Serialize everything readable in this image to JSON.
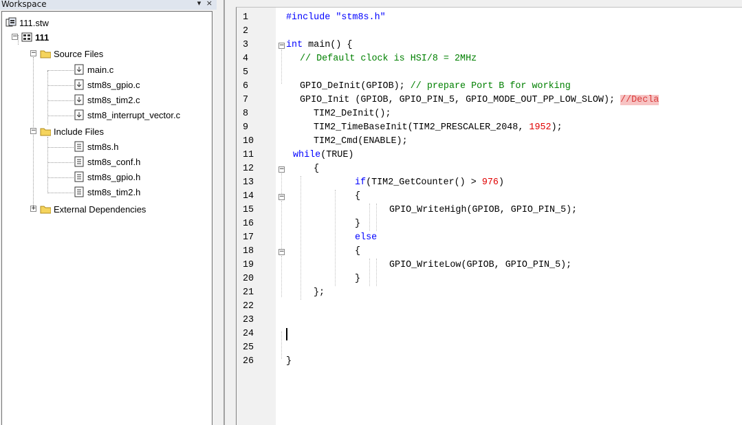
{
  "workspace": {
    "title": "Workspace",
    "controls": "▾ ×",
    "tree": {
      "workspace_file": "111.stw",
      "project": "111",
      "source_folder": "Source Files",
      "source_files": [
        "main.c",
        "stm8s_gpio.c",
        "stm8s_tim2.c",
        "stm8_interrupt_vector.c"
      ],
      "include_folder": "Include Files",
      "include_files": [
        "stm8s.h",
        "stm8s_conf.h",
        "stm8s_gpio.h",
        "stm8s_tim2.h"
      ],
      "external_folder": "External Dependencies"
    }
  },
  "editor": {
    "line_numbers": [
      "1",
      "2",
      "3",
      "4",
      "5",
      "6",
      "7",
      "8",
      "9",
      "10",
      "11",
      "12",
      "13",
      "14",
      "15",
      "16",
      "17",
      "18",
      "19",
      "20",
      "21",
      "22",
      "23",
      "24",
      "25",
      "26"
    ],
    "code": {
      "l1": "#include \"stm8s.h\"",
      "l3a": "int",
      "l3b": " main() {",
      "l4": "// Default clock is HSI/8 = 2MHz",
      "l6a": "GPIO_DeInit(GPIOB); ",
      "l6b": "// prepare Port B for working",
      "l7a": "GPIO_Init (GPIOB, GPIO_PIN_5, GPIO_MODE_OUT_PP_LOW_SLOW); ",
      "l7b": "//Decla",
      "l8": "TIM2_DeInit();",
      "l9a": "TIM2_TimeBaseInit(TIM2_PRESCALER_2048, ",
      "l9b": "1952",
      "l9c": ");",
      "l10": "TIM2_Cmd(ENABLE);",
      "l11a": "while",
      "l11b": "(TRUE)",
      "l12": "{",
      "l13a": "if",
      "l13b": "(TIM2_GetCounter() > ",
      "l13c": "976",
      "l13d": ")",
      "l14": "{",
      "l15": "GPIO_WriteHigh(GPIOB, GPIO_PIN_5);",
      "l16": "}",
      "l17": "else",
      "l18": "{",
      "l19": "GPIO_WriteLow(GPIOB, GPIO_PIN_5);",
      "l20": "}",
      "l21": "};",
      "l26": "}"
    }
  },
  "colors": {
    "keyword": "#0000ff",
    "comment": "#008000",
    "number": "#e00000",
    "highlight_comment_bg": "#f7c3c3"
  },
  "icons": [
    "workspace-icon",
    "project-icon",
    "folder-icon",
    "c-file-icon",
    "h-file-icon",
    "expand-icon",
    "collapse-icon",
    "close-icon",
    "dropdown-icon"
  ]
}
